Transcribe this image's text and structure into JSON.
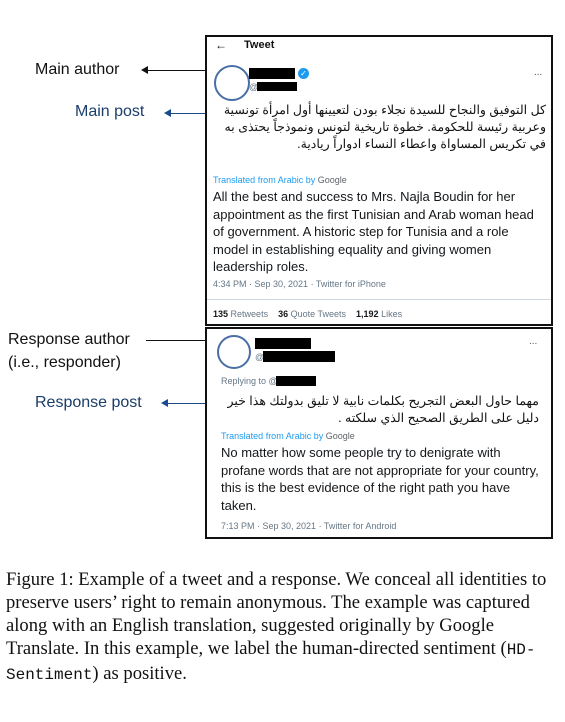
{
  "labels": {
    "main_author": "Main author",
    "main_post": "Main post",
    "response_author_line1": "Response author",
    "response_author_line2": "(i.e., responder)",
    "response_post": "Response post"
  },
  "main_tweet": {
    "header_back": "←",
    "header_title": "Tweet",
    "handle_prefix": "@",
    "more": "...",
    "arabic_text": "كل التوفيق والنجاح للسيدة نجلاء بودن لتعيينها أول امرأة تونسية وعربية رئيسة للحكومة. خطوة تاريخية لتونس ونموذجاً يحتذى به في تكريس المساواة واعطاء النساء ادواراً ريادية.",
    "translated_label": "Translated from Arabic by",
    "translator": "Google",
    "english_text": "All the best and success to Mrs. Najla Boudin for her appointment as the first Tunisian and Arab woman head of government. A historic step for Tunisia and a role model in establishing equality and giving women leadership roles.",
    "timestamp": "4:34 PM · Sep 30, 2021 · Twitter for iPhone",
    "retweets_count": "135",
    "retweets_label": "Retweets",
    "quote_count": "36",
    "quote_label": "Quote Tweets",
    "likes_count": "1,192",
    "likes_label": "Likes"
  },
  "response_tweet": {
    "handle_prefix": "@",
    "more": "...",
    "replying_to": "Replying to @",
    "arabic_text": "مهما حاول البعض التجريح بكلمات نابية لا تليق بدولتك هذا خير دليل على الطريق الصحيح الذي سلكته .",
    "translated_label": "Translated from Arabic by",
    "translator": "Google",
    "english_text": "No matter how some people try to denigrate with profane words that are not appropriate for your country, this is the best evidence of the right path you have taken.",
    "timestamp": "7:13 PM · Sep 30, 2021 · Twitter for Android"
  },
  "caption": {
    "prefix": "Figure 1: Example of a tweet and a response. We conceal all identities to preserve users’ right to remain anonymous. The example was captured along with an English translation, suggested originally by Google Translate. In this example, we label the human-directed sentiment (",
    "code": "HD-Sentiment",
    "suffix": ") as positive."
  },
  "colors": {
    "label_blue": "#1a3d6b",
    "link_blue": "#1d9bf0",
    "verified_blue": "#1d9bf0",
    "avatar_ring": "#4a6fa5"
  }
}
